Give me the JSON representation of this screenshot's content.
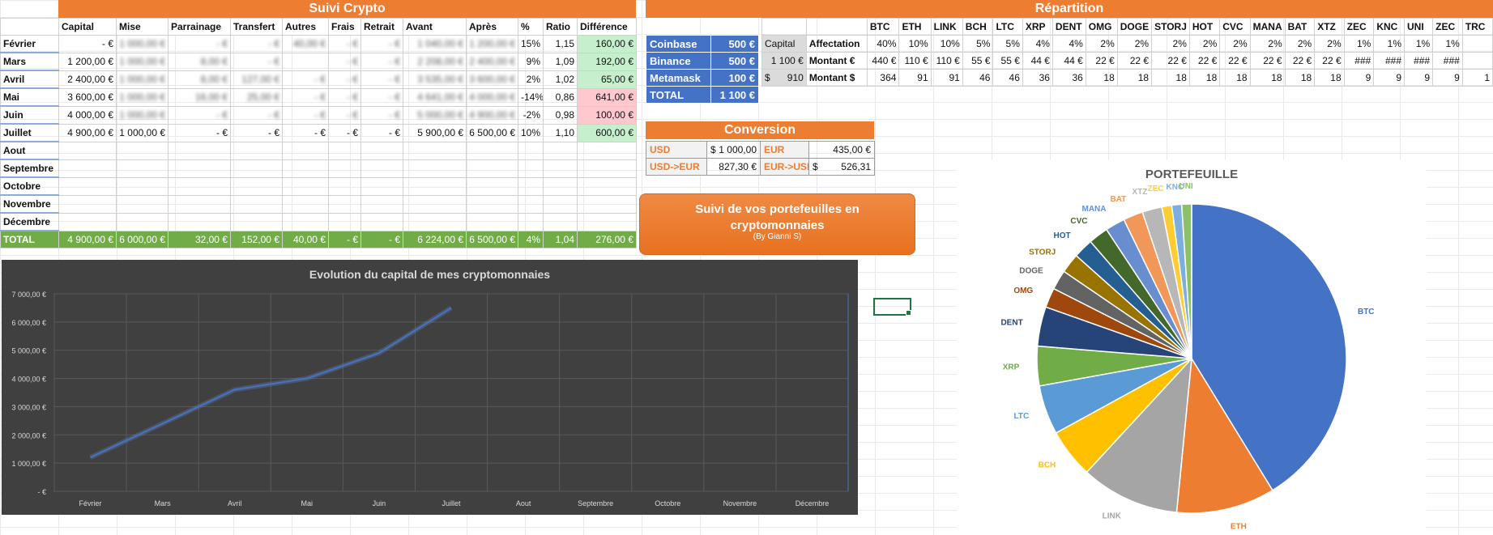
{
  "suivi": {
    "title": "Suivi Crypto",
    "headers": [
      "",
      "Capital",
      "Mise",
      "Parrainage",
      "Transfert",
      "Autres",
      "Frais",
      "Retrait",
      "Avant",
      "Après",
      "%",
      "Ratio",
      "Différence"
    ],
    "rows": [
      {
        "month": "Février",
        "capital": "- €",
        "mise": "1 000,00 €",
        "parrainage": "- €",
        "transfert": "- €",
        "autres": "40,00 €",
        "frais": "- €",
        "retrait": "- €",
        "avant": "1 040,00 €",
        "apres": "1 2​00,00 €",
        "pct": "15%",
        "ratio": "1,15",
        "diff": "160,00 €",
        "status": "pos"
      },
      {
        "month": "Mars",
        "capital": "1 200,00 €",
        "mise": "1 000,00 €",
        "parrainage": "8,00 €",
        "transfert": "- €",
        "autres": "",
        "frais": "- €",
        "retrait": "- €",
        "avant": "2 208,00 €",
        "apres": "2 400,00 €",
        "pct": "9%",
        "ratio": "1,09",
        "diff": "192,00 €",
        "status": "pos"
      },
      {
        "month": "Avril",
        "capital": "2 400,00 €",
        "mise": "1 000,00 €",
        "parrainage": "8,00 €",
        "transfert": "127,00 €",
        "autres": "- €",
        "frais": "- €",
        "retrait": "- €",
        "avant": "3 535,00 €",
        "apres": "3 600,00 €",
        "pct": "2%",
        "ratio": "1,02",
        "diff": "65,00 €",
        "status": "pos"
      },
      {
        "month": "Mai",
        "capital": "3 600,00 €",
        "mise": "1 000,00 €",
        "parrainage": "16,00 €",
        "transfert": "25,00 €",
        "autres": "- €",
        "frais": "- €",
        "retrait": "- €",
        "avant": "4 641,00 €",
        "apres": "4 000,00 €",
        "pct": "-14%",
        "ratio": "0,86",
        "diff": "641,00 €",
        "status": "neg"
      },
      {
        "month": "Juin",
        "capital": "4 000,00 €",
        "mise": "1 000,00 €",
        "parrainage": "- €",
        "transfert": "- €",
        "autres": "- €",
        "frais": "- €",
        "retrait": "- €",
        "avant": "5 000,00 €",
        "apres": "4 900,00 €",
        "pct": "-2%",
        "ratio": "0,98",
        "diff": "100,00 €",
        "status": "neg"
      },
      {
        "month": "Juillet",
        "capital": "4 900,00 €",
        "mise": "1 000,00 €",
        "parrainage": "- €",
        "transfert": "- €",
        "autres": "- €",
        "frais": "- €",
        "retrait": "- €",
        "avant": "5 900,00 €",
        "apres": "6 500,00 €",
        "pct": "10%",
        "ratio": "1,10",
        "diff": "600,00 €",
        "status": "pos"
      },
      {
        "month": "Aout"
      },
      {
        "month": "Septembre"
      },
      {
        "month": "Octobre"
      },
      {
        "month": "Novembre"
      },
      {
        "month": "Décembre"
      }
    ],
    "total": {
      "label": "TOTAL",
      "capital": "4 900,00 €",
      "mise": "6 000,00 €",
      "parrainage": "32,00 €",
      "transfert": "152,00 €",
      "autres": "40,00 €",
      "frais": "- €",
      "retrait": "- €",
      "avant": "6 224,00 €",
      "apres": "6 500,00 €",
      "pct": "4%",
      "ratio": "1,04",
      "diff": "276,00 €"
    }
  },
  "repartition": {
    "title": "Répartition",
    "wallets": [
      {
        "name": "Coinbase",
        "amount": "500 €"
      },
      {
        "name": "Binance",
        "amount": "500 €"
      },
      {
        "name": "Metamask",
        "amount": "100 €"
      },
      {
        "name": "TOTAL",
        "amount": "1 100 €"
      }
    ],
    "capital_label": "Capital",
    "capital_eur": "1 100 €",
    "capital_usd_symbol": "$",
    "capital_usd": "910",
    "row_labels": [
      "Affectation",
      "Montant €",
      "Montant $"
    ],
    "coins": [
      {
        "sym": "BTC",
        "pct": "40%",
        "eur": "440 €",
        "usd": "364"
      },
      {
        "sym": "ETH",
        "pct": "10%",
        "eur": "110 €",
        "usd": "91"
      },
      {
        "sym": "LINK",
        "pct": "10%",
        "eur": "110 €",
        "usd": "91"
      },
      {
        "sym": "BCH",
        "pct": "5%",
        "eur": "55 €",
        "usd": "46"
      },
      {
        "sym": "LTC",
        "pct": "5%",
        "eur": "55 €",
        "usd": "46"
      },
      {
        "sym": "XRP",
        "pct": "4%",
        "eur": "44 €",
        "usd": "36"
      },
      {
        "sym": "DENT",
        "pct": "4%",
        "eur": "44 €",
        "usd": "36"
      },
      {
        "sym": "OMG",
        "pct": "2%",
        "eur": "22 €",
        "usd": "18"
      },
      {
        "sym": "DOGE",
        "pct": "2%",
        "eur": "22 €",
        "usd": "18"
      },
      {
        "sym": "STORJ",
        "pct": "2%",
        "eur": "22 €",
        "usd": "18"
      },
      {
        "sym": "HOT",
        "pct": "2%",
        "eur": "22 €",
        "usd": "18"
      },
      {
        "sym": "CVC",
        "pct": "2%",
        "eur": "22 €",
        "usd": "18"
      },
      {
        "sym": "MANA",
        "pct": "2%",
        "eur": "22 €",
        "usd": "18"
      },
      {
        "sym": "BAT",
        "pct": "2%",
        "eur": "22 €",
        "usd": "18"
      },
      {
        "sym": "XTZ",
        "pct": "2%",
        "eur": "22 €",
        "usd": "18"
      },
      {
        "sym": "ZEC",
        "pct": "1%",
        "eur": "###",
        "usd": "9"
      },
      {
        "sym": "KNC",
        "pct": "1%",
        "eur": "###",
        "usd": "9"
      },
      {
        "sym": "UNI",
        "pct": "1%",
        "eur": "###",
        "usd": "9"
      },
      {
        "sym": "ZEC",
        "pct": "1%",
        "eur": "###",
        "usd": "9"
      },
      {
        "sym": "TRC",
        "pct": "",
        "eur": "",
        "usd": "1"
      }
    ]
  },
  "conversion": {
    "title": "Conversion",
    "usd_label": "USD",
    "usd_symbol": "$",
    "usd_value": "1 000,00",
    "eur_label": "EUR",
    "eur_value": "435,00 €",
    "usd_eur_label": "USD->EUR",
    "usd_eur_value": "827,30 €",
    "eur_usd_label": "EUR->USD",
    "eur_usd_symbol": "$",
    "eur_usd_value": "526,31"
  },
  "banner": {
    "line1": "Suivi de vos portefeuilles en",
    "line2": "cryptomonnaies",
    "author": "(By Gianni S)"
  },
  "chart_data": [
    {
      "type": "line",
      "title": "Evolution du capital de mes cryptomonnaies",
      "categories": [
        "Février",
        "Mars",
        "Avril",
        "Mai",
        "Juin",
        "Juillet",
        "Aout",
        "Septembre",
        "Octobre",
        "Novembre",
        "Décembre"
      ],
      "series": [
        {
          "values": [
            1200,
            2400,
            3600,
            4000,
            4900,
            6500,
            null,
            null,
            null,
            null,
            null
          ]
        }
      ],
      "ylim": [
        0,
        7000
      ],
      "yticks": [
        "- €",
        "1 000,00 €",
        "2 000,00 €",
        "3 000,00 €",
        "4 000,00 €",
        "5 000,00 €",
        "6 000,00 €",
        "7 000,00 €"
      ],
      "colors": {
        "bg": "#404040",
        "line": "#4472c4",
        "text": "#d9d9d9"
      }
    },
    {
      "type": "pie",
      "title": "PORTEFEUILLE",
      "labels": [
        "BTC",
        "ETH",
        "LINK",
        "BCH",
        "LTC",
        "XRP",
        "DENT",
        "OMG",
        "DOGE",
        "STORJ",
        "HOT",
        "CVC",
        "MANA",
        "BAT",
        "XTZ",
        "ZEC",
        "KNC",
        "UNI"
      ],
      "values": [
        40,
        10,
        10,
        5,
        5,
        4,
        4,
        2,
        2,
        2,
        2,
        2,
        2,
        2,
        2,
        1,
        1,
        1
      ],
      "colors": [
        "#4472c4",
        "#ed7d31",
        "#a5a5a5",
        "#ffc000",
        "#5b9bd5",
        "#70ad47",
        "#264478",
        "#9e480e",
        "#636363",
        "#997300",
        "#255e91",
        "#43682b",
        "#698ed0",
        "#f1975a",
        "#b7b7b7",
        "#ffcd33",
        "#7cafdd",
        "#8cc168"
      ]
    }
  ]
}
